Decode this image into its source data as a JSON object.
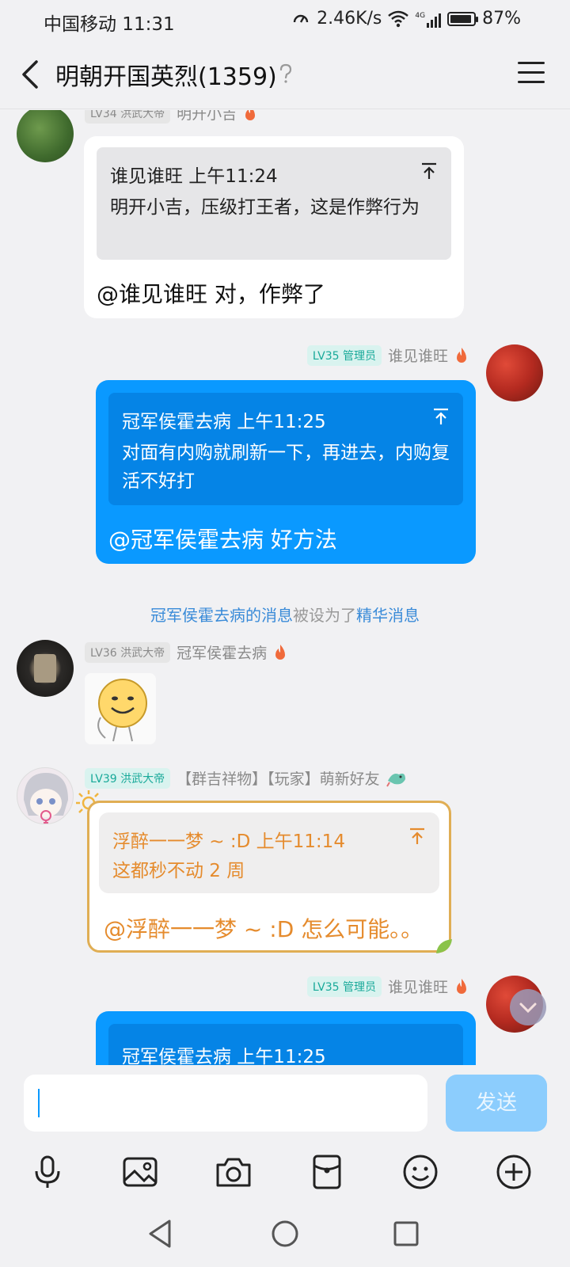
{
  "status_bar": {
    "carrier_time": "中国移动 11:31",
    "net_speed": "2.46K/s",
    "signal_label": "4G",
    "battery": "87%"
  },
  "header": {
    "title": "明朝开国英烈(1359)"
  },
  "messages": [
    {
      "level": "LV34 洪武大帝",
      "sender": "明开小吉",
      "quote_head": "谁见谁旺 上午11:24",
      "quote_body": "明开小吉，压级打王者，这是作弊行为",
      "text": "@谁见谁旺 对，作弊了"
    },
    {
      "level": "LV35 管理员",
      "sender": "谁见谁旺",
      "quote_head": "冠军侯霍去病 上午11:25",
      "quote_body": "对面有内购就刷新一下，再进去，内购复活不好打",
      "text": "@冠军侯霍去病 好方法"
    },
    {
      "level": "LV36 洪武大帝",
      "sender": "冠军侯霍去病"
    },
    {
      "level": "LV39 洪武大帝",
      "sender": "【群吉祥物】【玩家】萌新好友",
      "quote_head": "浮醉一一梦 ~ :D 上午11:14",
      "quote_body": "这都秒不动 2 周",
      "text": "@浮醉一一梦 ~ :D 怎么可能。。"
    },
    {
      "level": "LV35 管理员",
      "sender": "谁见谁旺",
      "quote_head": "冠军侯霍去病 上午11:25"
    }
  ],
  "system": {
    "part1": "冠军侯霍去病的消息",
    "part2": "被设为了",
    "part3": "精华消息"
  },
  "input": {
    "placeholder": "",
    "send_label": "发送"
  },
  "colors": {
    "accent_blue": "#0a99ff",
    "send_disabled": "#8ccdfd",
    "gold_border": "#e0ae54",
    "quote_gold_text": "#e58b2d"
  }
}
